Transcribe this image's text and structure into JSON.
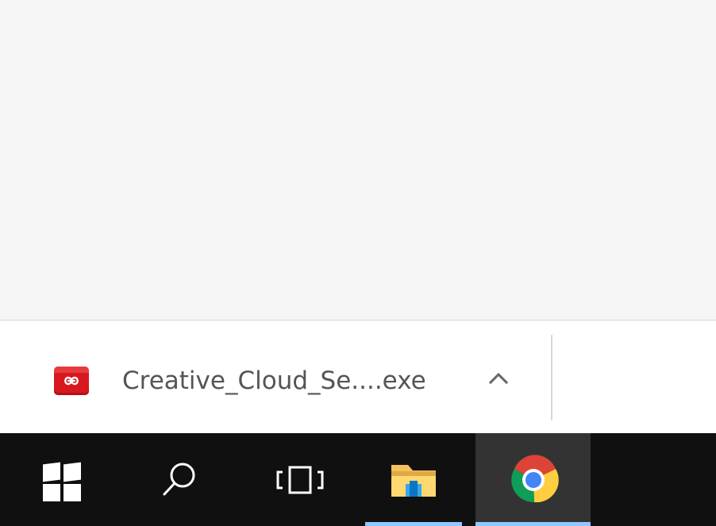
{
  "download_shelf": {
    "file_name": "Creative_Cloud_Se....exe",
    "file_icon": "adobe-creative-cloud-icon",
    "options_icon": "chevron-up-icon"
  },
  "taskbar": {
    "items": [
      {
        "name": "start",
        "icon": "windows-logo-icon"
      },
      {
        "name": "search",
        "icon": "search-icon"
      },
      {
        "name": "task-view",
        "icon": "task-view-icon"
      },
      {
        "name": "file-explorer",
        "icon": "folder-icon"
      },
      {
        "name": "google-chrome",
        "icon": "chrome-icon",
        "active": true
      }
    ]
  },
  "colors": {
    "page_background": "#f5f5f5",
    "download_icon": "#d7191f",
    "taskbar": "#101010",
    "active_task": "#333333",
    "active_indicator": "#8ec8ff"
  }
}
